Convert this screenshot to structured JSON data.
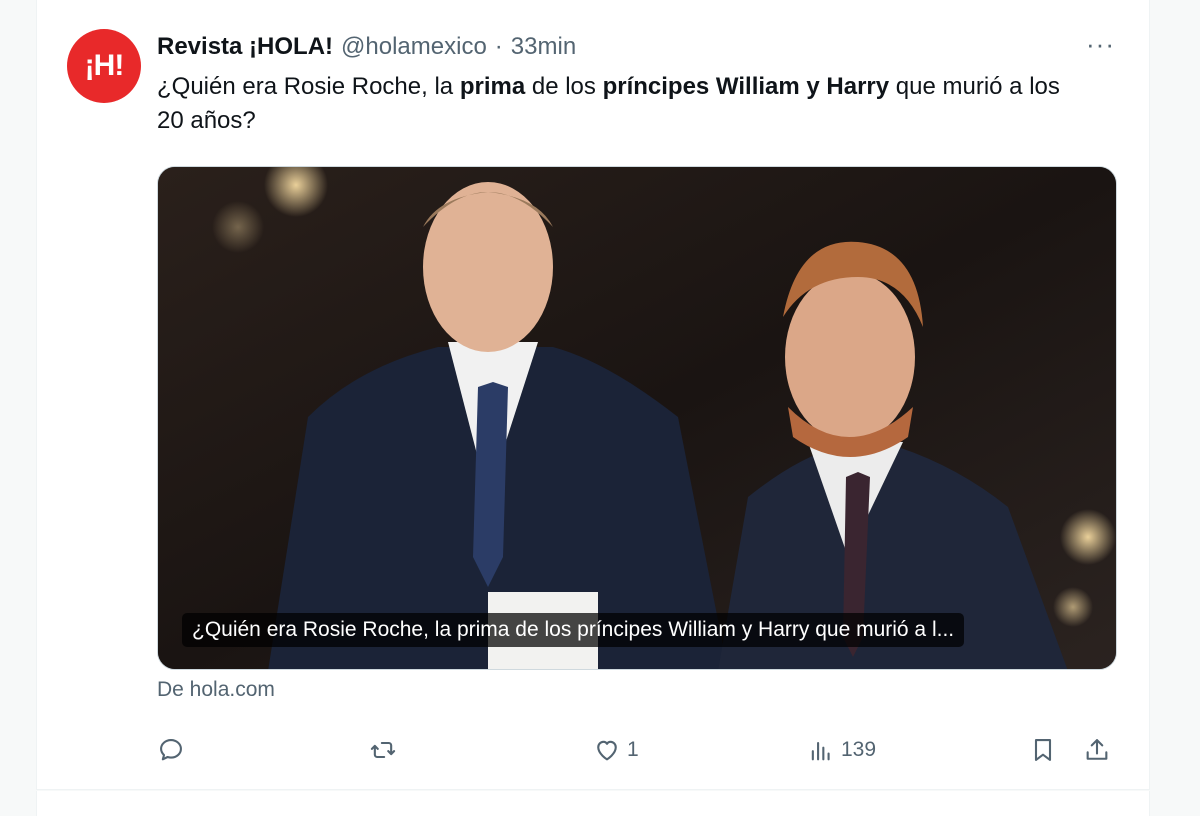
{
  "tweet": {
    "display_name": "Revista ¡HOLA!",
    "handle": "@holamexico",
    "separator": "·",
    "time": "33min",
    "more_label": "···",
    "avatar_text": "¡H!",
    "text_parts": [
      {
        "text": "¿Quién era Rosie Roche, la ",
        "bold": false
      },
      {
        "text": "prima",
        "bold": true
      },
      {
        "text": " de los ",
        "bold": false
      },
      {
        "text": "príncipes William y Harry",
        "bold": true
      },
      {
        "text": " que murió a los 20 años?",
        "bold": false
      }
    ],
    "media_caption": "¿Quién era Rosie Roche, la prima de los príncipes William y Harry que murió a l...",
    "source": "De hola.com"
  },
  "actions": {
    "reply_count": "",
    "retweet_count": "",
    "like_count": "1",
    "views_count": "139"
  },
  "colors": {
    "brand_red": "#e8292a",
    "muted_text": "#536471",
    "border": "#cfd9de"
  },
  "icons": [
    "reply-icon",
    "retweet-icon",
    "like-icon",
    "views-icon",
    "bookmark-icon",
    "share-icon",
    "more-icon"
  ]
}
